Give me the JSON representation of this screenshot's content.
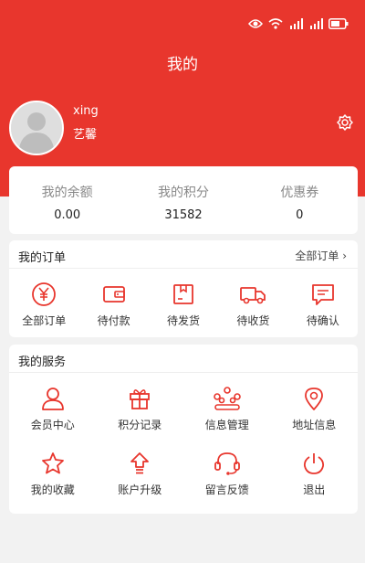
{
  "header": {
    "title": "我的",
    "bg_color": "#e8362d"
  },
  "status_bar": {
    "icons": [
      "eye-icon",
      "wifi-icon",
      "signal-5g-icon",
      "signal-4g-icon",
      "battery-icon"
    ]
  },
  "profile": {
    "username": "xing",
    "nickname": "艺馨"
  },
  "assets": [
    {
      "label": "我的余额",
      "value": "0.00"
    },
    {
      "label": "我的积分",
      "value": "31582"
    },
    {
      "label": "优惠券",
      "value": "0"
    }
  ],
  "orders": {
    "title": "我的订单",
    "all_link": "全部订单",
    "items": [
      {
        "label": "全部订单",
        "icon": "yen-icon"
      },
      {
        "label": "待付款",
        "icon": "wallet-icon"
      },
      {
        "label": "待发货",
        "icon": "box-icon"
      },
      {
        "label": "待收货",
        "icon": "truck-icon"
      },
      {
        "label": "待确认",
        "icon": "message-icon"
      }
    ]
  },
  "services": {
    "title": "我的服务",
    "items": [
      {
        "label": "会员中心",
        "icon": "user-icon"
      },
      {
        "label": "积分记录",
        "icon": "gift-icon"
      },
      {
        "label": "信息管理",
        "icon": "network-icon"
      },
      {
        "label": "地址信息",
        "icon": "location-icon"
      },
      {
        "label": "我的收藏",
        "icon": "star-icon"
      },
      {
        "label": "账户升级",
        "icon": "upgrade-icon"
      },
      {
        "label": "留言反馈",
        "icon": "headset-icon"
      },
      {
        "label": "退出",
        "icon": "power-icon"
      }
    ]
  },
  "accent_color": "#e8362d"
}
